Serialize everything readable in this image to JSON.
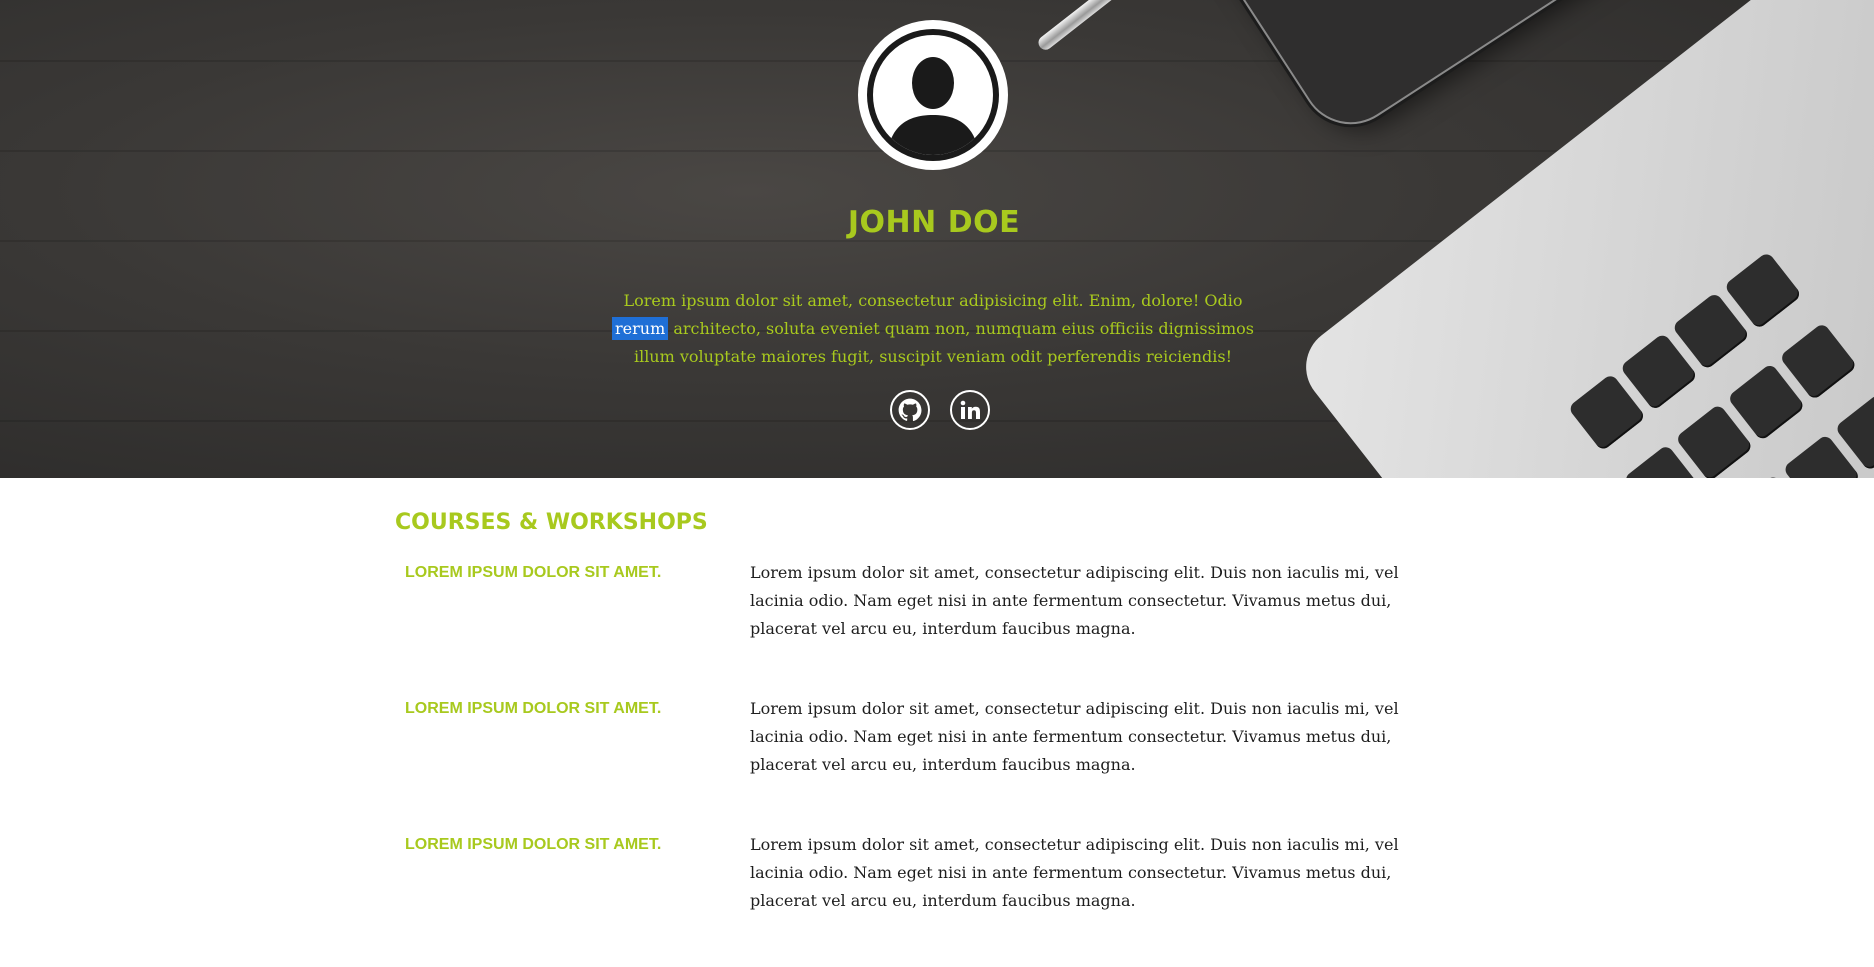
{
  "hero": {
    "name": "JOHN DOE",
    "bio_before": "Lorem ipsum dolor sit amet, consectetur adipisicing elit. Enim, dolore! Odio ",
    "bio_selected": "rerum",
    "bio_after": " architecto, soluta eveniet quam non, numquam eius officiis dignissimos illum voluptate maiores fugit, suscipit veniam odit perferendis reiciendis!",
    "social_links": [
      {
        "icon": "github-icon"
      },
      {
        "icon": "linkedin-icon"
      }
    ]
  },
  "courses": {
    "title": "COURSES & WORKSHOPS",
    "items": [
      {
        "title": "LOREM IPSUM DOLOR SIT AMET.",
        "description": "Lorem ipsum dolor sit amet, consectetur adipiscing elit. Duis non iaculis mi, vel lacinia odio. Nam eget nisi in ante fermentum consectetur. Vivamus metus dui, placerat vel arcu eu, interdum faucibus magna."
      },
      {
        "title": "LOREM IPSUM DOLOR SIT AMET.",
        "description": "Lorem ipsum dolor sit amet, consectetur adipiscing elit. Duis non iaculis mi, vel lacinia odio. Nam eget nisi in ante fermentum consectetur. Vivamus metus dui, placerat vel arcu eu, interdum faucibus magna."
      },
      {
        "title": "LOREM IPSUM DOLOR SIT AMET.",
        "description": "Lorem ipsum dolor sit amet, consectetur adipiscing elit. Duis non iaculis mi, vel lacinia odio. Nam eget nisi in ante fermentum consectetur. Vivamus metus dui, placerat vel arcu eu, interdum faucibus magna."
      }
    ]
  },
  "colors": {
    "accent": "#a8c91e",
    "selection": "#1f6fd6",
    "hero_background": "#3a3836",
    "body_text": "#1e1e1e"
  }
}
